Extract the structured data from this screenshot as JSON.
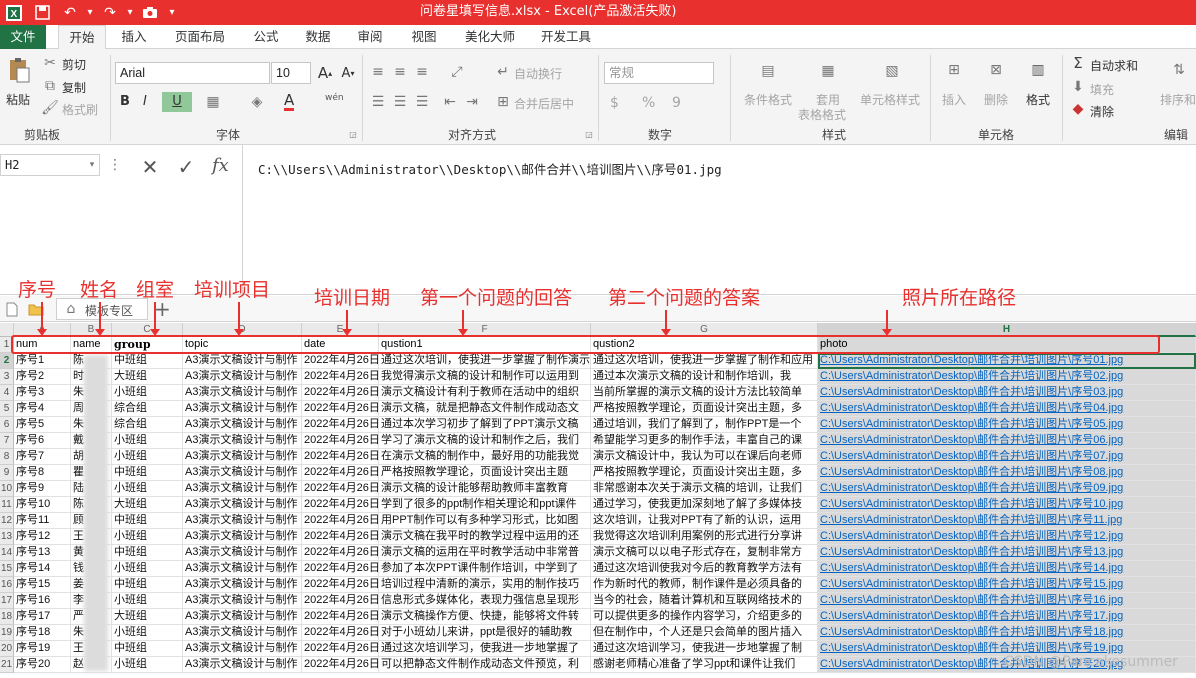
{
  "window": {
    "title": "问卷星填写信息.xlsx - Excel(产品激活失败)"
  },
  "tabs": [
    {
      "label": "文件"
    },
    {
      "label": "开始"
    },
    {
      "label": "插入"
    },
    {
      "label": "页面布局"
    },
    {
      "label": "公式"
    },
    {
      "label": "数据"
    },
    {
      "label": "审阅"
    },
    {
      "label": "视图"
    },
    {
      "label": "美化大师"
    },
    {
      "label": "开发工具"
    }
  ],
  "ribbon": {
    "clipboard": {
      "paste": "粘贴",
      "cut": "剪切",
      "copy": "复制",
      "format_painter": "格式刷",
      "label": "剪贴板"
    },
    "font": {
      "name": "Arial",
      "size": "10",
      "bold": "B",
      "italic": "I",
      "underline": "U",
      "label": "字体",
      "wen": "wén",
      "font_a": "A"
    },
    "align": {
      "wrap": "自动换行",
      "merge": "合并后居中",
      "label": "对齐方式"
    },
    "number": {
      "format": "常规",
      "currency": "$",
      "percent": "%",
      "comma": "9",
      "label": "数字"
    },
    "styles": {
      "conditional": "条件格式",
      "table1": "套用",
      "table2": "表格格式",
      "cell_styles": "单元格样式",
      "label": "样式"
    },
    "cells": {
      "insert": "插入",
      "delete": "删除",
      "format": "格式",
      "label": "单元格"
    },
    "editing": {
      "autosum": "自动求和",
      "fill": "填充",
      "clear": "清除",
      "sort": "排序和",
      "label": "编辑"
    }
  },
  "formula_bar": {
    "name_box": "H2",
    "fx": "fx",
    "content": "C:\\\\Users\\\\Administrator\\\\Desktop\\\\邮件合并\\\\培训图片\\\\序号01.jpg"
  },
  "sheet_tabs": {
    "template_tab": "模板专区",
    "add": "+"
  },
  "annotations": [
    "序号",
    "姓名",
    "组室",
    "培训项目",
    "培训日期",
    "第一个问题的回答",
    "第二个问题的答案",
    "照片所在路径"
  ],
  "columns": [
    "A",
    "B",
    "C",
    "D",
    "E",
    "F",
    "G",
    "H"
  ],
  "headers": [
    "num",
    "name",
    "group",
    "topic",
    "date",
    "qustion1",
    "qustion2",
    "photo"
  ],
  "rows": [
    [
      "序号1",
      "陈",
      "中班组",
      "A3演示文稿设计与制作",
      "2022年4月26日",
      "通过这次培训，使我进一步掌握了制作演示文稿",
      "通过这次培训，使我进一步掌握了制作和应用",
      "C:\\Users\\Administrator\\Desktop\\邮件合并\\培训图片\\序号01.jpg"
    ],
    [
      "序号2",
      "时",
      "大班组",
      "A3演示文稿设计与制作",
      "2022年4月26日",
      "我觉得演示文稿的设计和制作可以运用到",
      "通过本次演示文稿的设计和制作培训，我",
      "C:\\Users\\Administrator\\Desktop\\邮件合并\\培训图片\\序号02.jpg"
    ],
    [
      "序号3",
      "朱",
      "小班组",
      "A3演示文稿设计与制作",
      "2022年4月26日",
      "演示文稿设计有利于教师在活动中的组织",
      "当前所掌握的演示文稿的设计方法比较简单",
      "C:\\Users\\Administrator\\Desktop\\邮件合并\\培训图片\\序号03.jpg"
    ],
    [
      "序号4",
      "周",
      "综合组",
      "A3演示文稿设计与制作",
      "2022年4月26日",
      "演示文稿，就是把静态文件制作成动态文",
      "严格按照教学理论，页面设计突出主题，多",
      "C:\\Users\\Administrator\\Desktop\\邮件合并\\培训图片\\序号04.jpg"
    ],
    [
      "序号5",
      "朱",
      "综合组",
      "A3演示文稿设计与制作",
      "2022年4月26日",
      "通过本次学习初步了解到了PPT演示文稿",
      "通过培训，我们了解到了，制作PPT是一个",
      "C:\\Users\\Administrator\\Desktop\\邮件合并\\培训图片\\序号05.jpg"
    ],
    [
      "序号6",
      "戴",
      "小班组",
      "A3演示文稿设计与制作",
      "2022年4月26日",
      "学习了演示文稿的设计和制作之后，我们",
      "希望能学习更多的制作手法，丰富自己的课",
      "C:\\Users\\Administrator\\Desktop\\邮件合并\\培训图片\\序号06.jpg"
    ],
    [
      "序号7",
      "胡",
      "小班组",
      "A3演示文稿设计与制作",
      "2022年4月26日",
      "在演示文稿的制作中，最好用的功能我觉",
      "演示文稿设计中，我认为可以在课后向老师",
      "C:\\Users\\Administrator\\Desktop\\邮件合并\\培训图片\\序号07.jpg"
    ],
    [
      "序号8",
      "瞿",
      "中班组",
      "A3演示文稿设计与制作",
      "2022年4月26日",
      "严格按照教学理论，页面设计突出主题",
      "严格按照教学理论，页面设计突出主题，多",
      "C:\\Users\\Administrator\\Desktop\\邮件合并\\培训图片\\序号08.jpg"
    ],
    [
      "序号9",
      "陆",
      "小班组",
      "A3演示文稿设计与制作",
      "2022年4月26日",
      "演示文稿的设计能够帮助教师丰富教育",
      "非常感谢本次关于演示文稿的培训，让我们",
      "C:\\Users\\Administrator\\Desktop\\邮件合并\\培训图片\\序号09.jpg"
    ],
    [
      "序号10",
      "陈",
      "大班组",
      "A3演示文稿设计与制作",
      "2022年4月26日",
      "学到了很多的ppt制作相关理论和ppt课件",
      "通过学习，使我更加深刻地了解了多媒体技",
      "C:\\Users\\Administrator\\Desktop\\邮件合并\\培训图片\\序号10.jpg"
    ],
    [
      "序号11",
      "顾",
      "中班组",
      "A3演示文稿设计与制作",
      "2022年4月26日",
      "用PPT制作可以有多种学习形式，比如图",
      "这次培训，让我对PPT有了新的认识，运用",
      "C:\\Users\\Administrator\\Desktop\\邮件合并\\培训图片\\序号11.jpg"
    ],
    [
      "序号12",
      "王",
      "小班组",
      "A3演示文稿设计与制作",
      "2022年4月26日",
      "演示文稿在我平时的教学过程中运用的还",
      "我觉得这次培训利用案例的形式进行分享讲",
      "C:\\Users\\Administrator\\Desktop\\邮件合并\\培训图片\\序号12.jpg"
    ],
    [
      "序号13",
      "黄",
      "中班组",
      "A3演示文稿设计与制作",
      "2022年4月26日",
      "演示文稿的运用在平时教学活动中非常普",
      "演示文稿可以以电子形式存在，复制非常方",
      "C:\\Users\\Administrator\\Desktop\\邮件合并\\培训图片\\序号13.jpg"
    ],
    [
      "序号14",
      "钱",
      "小班组",
      "A3演示文稿设计与制作",
      "2022年4月26日",
      "参加了本次PPT课件制作培训，中学到了",
      "通过这次培训使我对今后的教育教学方法有",
      "C:\\Users\\Administrator\\Desktop\\邮件合并\\培训图片\\序号14.jpg"
    ],
    [
      "序号15",
      "姜",
      "中班组",
      "A3演示文稿设计与制作",
      "2022年4月26日",
      "培训过程中清新的演示，实用的制作技巧",
      "作为新时代的教师，制作课件是必须具备的",
      "C:\\Users\\Administrator\\Desktop\\邮件合并\\培训图片\\序号15.jpg"
    ],
    [
      "序号16",
      "李",
      "小班组",
      "A3演示文稿设计与制作",
      "2022年4月26日",
      "信息形式多媒体化，表现力强信息呈现形",
      "当今的社会，随着计算机和互联网络技术的",
      "C:\\Users\\Administrator\\Desktop\\邮件合并\\培训图片\\序号16.jpg"
    ],
    [
      "序号17",
      "严",
      "大班组",
      "A3演示文稿设计与制作",
      "2022年4月26日",
      "演示文稿操作方便、快捷，能够将文件转",
      "可以提供更多的操作内容学习，介绍更多的",
      "C:\\Users\\Administrator\\Desktop\\邮件合并\\培训图片\\序号17.jpg"
    ],
    [
      "序号18",
      "朱",
      "小班组",
      "A3演示文稿设计与制作",
      "2022年4月26日",
      "对于小班幼儿来讲，ppt是很好的辅助教",
      "但在制作中，个人还是只会简单的图片插入",
      "C:\\Users\\Administrator\\Desktop\\邮件合并\\培训图片\\序号18.jpg"
    ],
    [
      "序号19",
      "王",
      "中班组",
      "A3演示文稿设计与制作",
      "2022年4月26日",
      "通过这次培训学习，使我进一步地掌握了",
      "通过这次培训学习，使我进一步地掌握了制",
      "C:\\Users\\Administrator\\Desktop\\邮件合并\\培训图片\\序号19.jpg"
    ],
    [
      "序号20",
      "赵",
      "小班组",
      "A3演示文稿设计与制作",
      "2022年4月26日",
      "可以把静态文件制作成动态文件预览，利",
      "感谢老师精心准备了学习ppt和课件让我们",
      "C:\\Users\\Administrator\\Desktop\\邮件合并\\培训图片\\序号20.jpg"
    ]
  ],
  "watermark": "CSDN @Pancakesummer"
}
